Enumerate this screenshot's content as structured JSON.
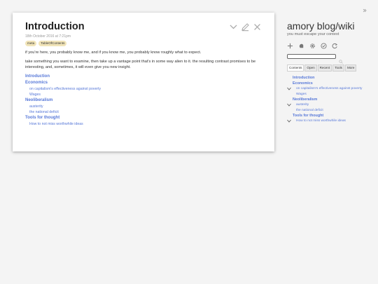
{
  "story": {
    "title": "Introduction",
    "subtitle": "18th October 2016 at 7:21pm",
    "tags": [
      "meta",
      "TableOfContents"
    ],
    "paragraphs": [
      "if you're here, you probably know me, and if you know me, you probably know roughly what to expect.",
      "take something you want to examine, then take up a vantage point that's in some way alien to it. the resulting contrast promises to be interesting, and, sometimes, it will even give you new insight."
    ],
    "toc": [
      {
        "label": "Introduction",
        "children": []
      },
      {
        "label": "Economics",
        "children": [
          "on capitalism's effectiveness against poverty",
          "Wages"
        ]
      },
      {
        "label": "Neoliberalism",
        "children": [
          "austerity",
          "the national deficit"
        ]
      },
      {
        "label": "Tools for thought",
        "children": [
          "How to not miss worthwhile ideas"
        ]
      }
    ]
  },
  "sidebar": {
    "site_title": "amory blog/wiki",
    "site_subtitle": "you must escape your context",
    "search_placeholder": "",
    "tabs": [
      "Contents",
      "Open",
      "Recent",
      "Tools",
      "More"
    ],
    "active_tab": "Contents",
    "toc": [
      {
        "label": "Introduction",
        "expanded": false,
        "children": []
      },
      {
        "label": "Economics",
        "expanded": true,
        "children": [
          "on capitalism's effectiveness against poverty",
          "Wages"
        ]
      },
      {
        "label": "Neoliberalism",
        "expanded": true,
        "children": [
          "austerity",
          "the national deficit"
        ]
      },
      {
        "label": "Tools for thought",
        "expanded": true,
        "children": [
          "How to not miss worthwhile ideas"
        ]
      }
    ]
  },
  "colors": {
    "link": "#5778d8",
    "tag_bg": "#f1e4b8",
    "page_bg": "#f4f4f4"
  }
}
